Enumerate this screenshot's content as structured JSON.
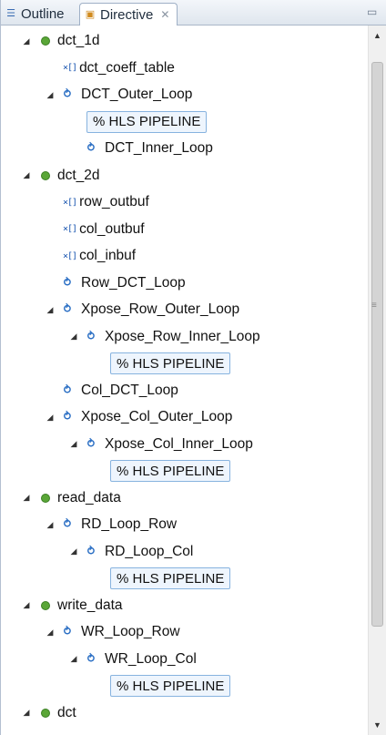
{
  "tabs": {
    "outline": "Outline",
    "directive": "Directive",
    "directive_close": "✕"
  },
  "tree": [
    {
      "kind": "function",
      "label": "dct_1d",
      "level": 0,
      "expanded": true
    },
    {
      "kind": "array",
      "label": "dct_coeff_table",
      "level": 1
    },
    {
      "kind": "loop",
      "label": "DCT_Outer_Loop",
      "level": 1,
      "expanded": true
    },
    {
      "kind": "pragma",
      "label": "% HLS PIPELINE",
      "level": 2
    },
    {
      "kind": "loop",
      "label": "DCT_Inner_Loop",
      "level": 2
    },
    {
      "kind": "function",
      "label": "dct_2d",
      "level": 0,
      "expanded": true
    },
    {
      "kind": "array",
      "label": "row_outbuf",
      "level": 1
    },
    {
      "kind": "array",
      "label": "col_outbuf",
      "level": 1
    },
    {
      "kind": "array",
      "label": "col_inbuf",
      "level": 1
    },
    {
      "kind": "loop",
      "label": "Row_DCT_Loop",
      "level": 1
    },
    {
      "kind": "loop",
      "label": "Xpose_Row_Outer_Loop",
      "level": 1,
      "expanded": true
    },
    {
      "kind": "loop",
      "label": "Xpose_Row_Inner_Loop",
      "level": 2,
      "expanded": true
    },
    {
      "kind": "pragma",
      "label": "% HLS PIPELINE",
      "level": 3
    },
    {
      "kind": "loop",
      "label": "Col_DCT_Loop",
      "level": 1
    },
    {
      "kind": "loop",
      "label": "Xpose_Col_Outer_Loop",
      "level": 1,
      "expanded": true
    },
    {
      "kind": "loop",
      "label": "Xpose_Col_Inner_Loop",
      "level": 2,
      "expanded": true
    },
    {
      "kind": "pragma",
      "label": "% HLS PIPELINE",
      "level": 3
    },
    {
      "kind": "function",
      "label": "read_data",
      "level": 0,
      "expanded": true
    },
    {
      "kind": "loop",
      "label": "RD_Loop_Row",
      "level": 1,
      "expanded": true
    },
    {
      "kind": "loop",
      "label": "RD_Loop_Col",
      "level": 2,
      "expanded": true
    },
    {
      "kind": "pragma",
      "label": "% HLS PIPELINE",
      "level": 3
    },
    {
      "kind": "function",
      "label": "write_data",
      "level": 0,
      "expanded": true
    },
    {
      "kind": "loop",
      "label": "WR_Loop_Row",
      "level": 1,
      "expanded": true
    },
    {
      "kind": "loop",
      "label": "WR_Loop_Col",
      "level": 2,
      "expanded": true
    },
    {
      "kind": "pragma",
      "label": "% HLS PIPELINE",
      "level": 3
    },
    {
      "kind": "function",
      "label": "dct",
      "level": 0,
      "expanded": true
    }
  ],
  "colors": {
    "function_dot": "#5aa637",
    "loop_icon": "#2b6fc4",
    "pragma_border": "#87b3df",
    "pragma_bg": "#eef5fd"
  }
}
